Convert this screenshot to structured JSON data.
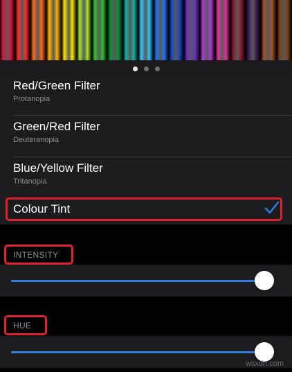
{
  "banner": {
    "pencil_colors": [
      "#e1143a",
      "#ff2a2a",
      "#ff6a1a",
      "#ffb300",
      "#ffe600",
      "#a6e22e",
      "#2fc12f",
      "#0a8f3a",
      "#12b3a6",
      "#38c6f4",
      "#1e73e8",
      "#1848c8",
      "#6a2fc8",
      "#b23ad8",
      "#e2339a",
      "#8a1a2e",
      "#3c1a52",
      "#a0522d",
      "#7b3f16"
    ],
    "active_page_index": 0
  },
  "filters": [
    {
      "title": "Red/Green Filter",
      "subtitle": "Protanopia"
    },
    {
      "title": "Green/Red Filter",
      "subtitle": "Deuteranopia"
    },
    {
      "title": "Blue/Yellow Filter",
      "subtitle": "Tritanopia"
    }
  ],
  "colour_tint": {
    "title": "Colour Tint",
    "selected": true,
    "check_icon": "checkmark-icon"
  },
  "intensity": {
    "label": "INTENSITY",
    "value": 1.0
  },
  "hue": {
    "label": "HUE",
    "value": 1.0
  },
  "colors": {
    "accent": "#2f7fe0",
    "highlight": "#e0212f"
  },
  "watermark": "wsxdn.com"
}
